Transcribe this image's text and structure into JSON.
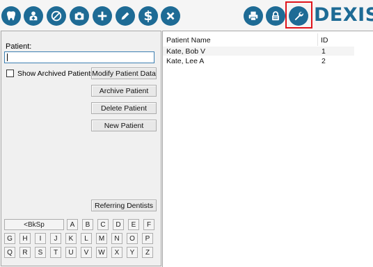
{
  "toolbar": {
    "icons": [
      "tooth-icon",
      "patient-icon",
      "no-entry-icon",
      "camera-icon",
      "plus-icon",
      "pencil-icon",
      "dollar-icon",
      "close-icon",
      "print-icon",
      "lock-icon",
      "wrench-icon"
    ],
    "brand": "DEXIS",
    "accent": "#1e6b95",
    "highlight": "#e0141c"
  },
  "left": {
    "patient_label": "Patient:",
    "patient_value": "",
    "show_archived_label": "Show Archived Patients",
    "modify_label": "Modify Patient Data",
    "archive_label": "Archive Patient",
    "delete_label": "Delete Patient",
    "new_label": "New Patient",
    "referring_label": "Referring Dentists"
  },
  "keyboard": {
    "bksp": "<BkSp",
    "row1": [
      "A",
      "B",
      "C",
      "D",
      "E",
      "F"
    ],
    "row2": [
      "G",
      "H",
      "I",
      "J",
      "K",
      "L",
      "M",
      "N",
      "O",
      "P"
    ],
    "row3": [
      "Q",
      "R",
      "S",
      "T",
      "U",
      "V",
      "W",
      "X",
      "Y",
      "Z"
    ]
  },
  "table": {
    "headers": {
      "name": "Patient Name",
      "id": "ID"
    },
    "rows": [
      {
        "name": "Kate, Bob V",
        "id": "1"
      },
      {
        "name": "Kate, Lee A",
        "id": "2"
      }
    ]
  }
}
